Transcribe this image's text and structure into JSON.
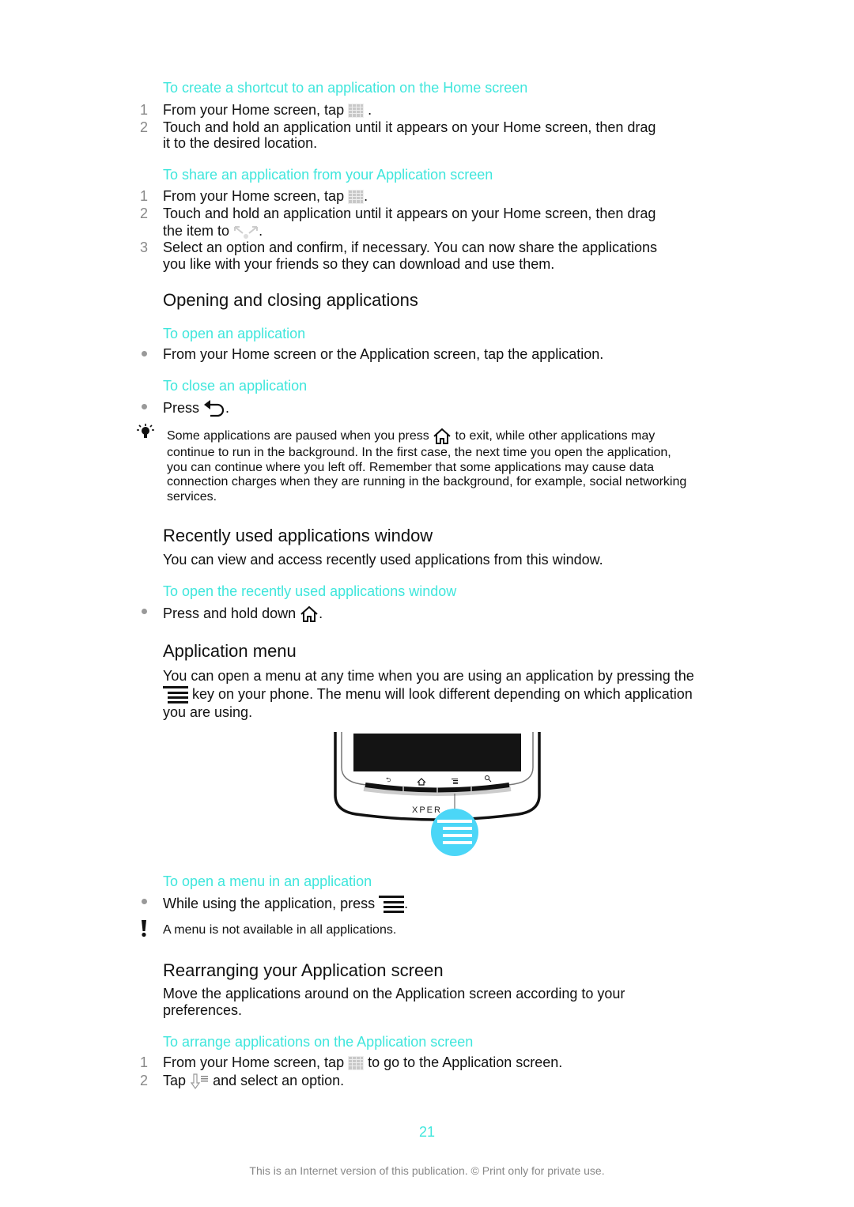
{
  "colors": {
    "accent": "#3fe6dc",
    "text": "#111111",
    "muted": "#888888"
  },
  "s1": {
    "title": "To create a shortcut to an application on the Home screen",
    "step1_a": "From your Home screen, tap",
    "step1_b": " .",
    "step2_l1": "Touch and hold an application until it appears on your Home screen, then drag",
    "step2_l2": "it to the desired location."
  },
  "s2": {
    "title": "To share an application from your Application screen",
    "step1_a": "From your Home screen, tap",
    "step1_b": ".",
    "step2_l1": "Touch and hold an application until it appears on your Home screen, then drag",
    "step2_l2a": "the item to",
    "step2_l2b": ".",
    "step3_l1": "Select an option and confirm, if necessary. You can now share the applications",
    "step3_l2": "you like with your friends so they can download and use them."
  },
  "h_open": "Opening and closing applications",
  "s3": {
    "title": "To open an application",
    "bullet": "From your Home screen or the Application screen, tap the application."
  },
  "s4": {
    "title": "To close an application",
    "bullet_a": "Press",
    "bullet_b": "."
  },
  "tip": {
    "l1a": "Some applications are paused when you press",
    "l1b": "to exit, while other applications may",
    "l2": "continue to run in the background. In the first case, the next time you open the application,",
    "l3": "you can continue where you left off. Remember that some applications may cause data",
    "l4": "connection charges when they are running in the background, for example, social networking",
    "l5": "services."
  },
  "h_recent": "Recently used applications window",
  "recent_p": "You can view and access recently used applications from this window.",
  "s5": {
    "title": "To open the recently used applications window",
    "bullet_a": "Press and hold down",
    "bullet_b": "."
  },
  "h_menu": "Application menu",
  "menu_p": {
    "l1": "You can open a menu at any time when you are using an application by pressing the",
    "l2": "key on your phone. The menu will look different depending on which application",
    "l3": "you are using."
  },
  "phone_brand": "XPER",
  "s6": {
    "title": "To open a menu in an application",
    "bullet_a": "While using the application, press",
    "bullet_b": ".",
    "note": "A menu is not available in all applications."
  },
  "h_rearr": "Rearranging your Application screen",
  "rearr_p": {
    "l1": "Move the applications around on the Application screen according to your",
    "l2": "preferences."
  },
  "s7": {
    "title": "To arrange applications on the Application screen",
    "step1_a": "From your Home screen, tap",
    "step1_b": "to go to the Application screen.",
    "step2_a": "Tap",
    "step2_b": "and select an option."
  },
  "nums": [
    "1",
    "2",
    "3"
  ],
  "page_number": "21",
  "footer": "This is an Internet version of this publication. © Print only for private use."
}
